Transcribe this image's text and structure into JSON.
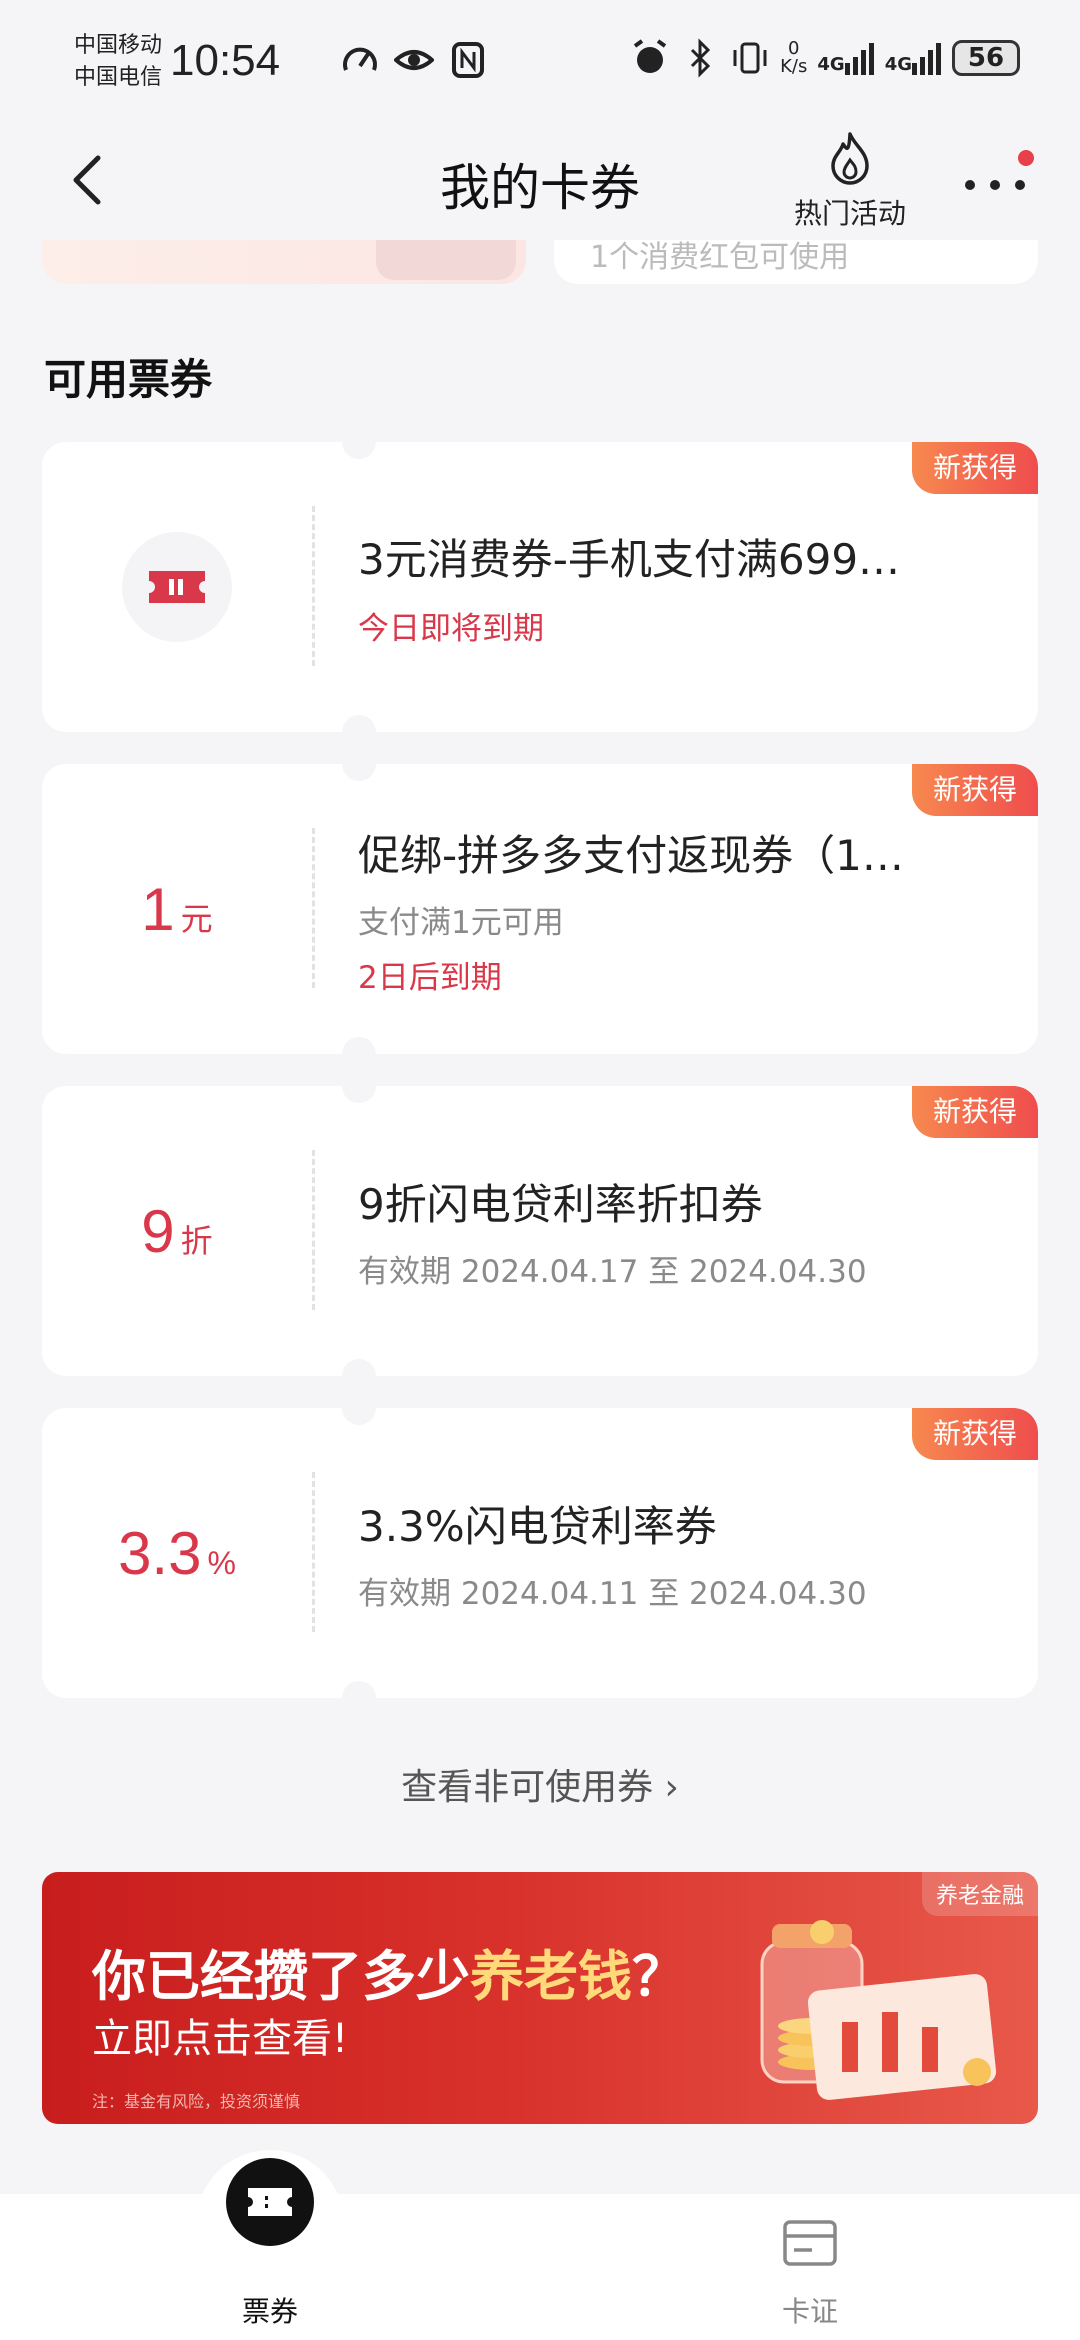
{
  "status_bar": {
    "carrier_1": "中国移动",
    "carrier_2": "中国电信",
    "time": "10:54",
    "net_speed_value": "0",
    "net_speed_unit": "K/s",
    "net_1": "4G",
    "net_2": "4G",
    "battery": "56"
  },
  "nav": {
    "title": "我的卡券",
    "hot_activity_label": "热门活动"
  },
  "peek": {
    "right_text": "1个消费红包可使用"
  },
  "section": {
    "title": "可用票券"
  },
  "coupons": [
    {
      "badge": "新获得",
      "value": "",
      "unit": "",
      "icon": "ticket-icon",
      "title": "3元消费券-手机支付满699…",
      "subtitle": "",
      "expiry": "今日即将到期"
    },
    {
      "badge": "新获得",
      "value": "1",
      "unit": "元",
      "title": "促绑-拼多多支付返现券（1…",
      "subtitle": "支付满1元可用",
      "expiry": "2日后到期"
    },
    {
      "badge": "新获得",
      "value": "9",
      "unit": "折",
      "title": "9折闪电贷利率折扣券",
      "subtitle": "有效期 2024.04.17 至 2024.04.30",
      "expiry": ""
    },
    {
      "badge": "新获得",
      "value": "3.3",
      "unit": "%",
      "title": "3.3%闪电贷利率券",
      "subtitle": "有效期 2024.04.11 至 2024.04.30",
      "expiry": ""
    }
  ],
  "view_unusable": "查看非可使用券 ›",
  "banner": {
    "tag": "养老金融",
    "headline_prefix": "你已经攒了多少",
    "headline_highlight": "养老钱",
    "headline_suffix": "？",
    "subline": "立即点击查看!",
    "note": "注：基金有风险，投资须谨慎"
  },
  "tabs": [
    {
      "label": "票券",
      "active": true,
      "icon": "ticket-icon"
    },
    {
      "label": "卡证",
      "active": false,
      "icon": "card-icon"
    }
  ],
  "colors": {
    "accent_red": "#d9384a",
    "badge_gradient_start": "#f7894f",
    "badge_gradient_end": "#ef4d4d",
    "background": "#f5f5f7"
  }
}
